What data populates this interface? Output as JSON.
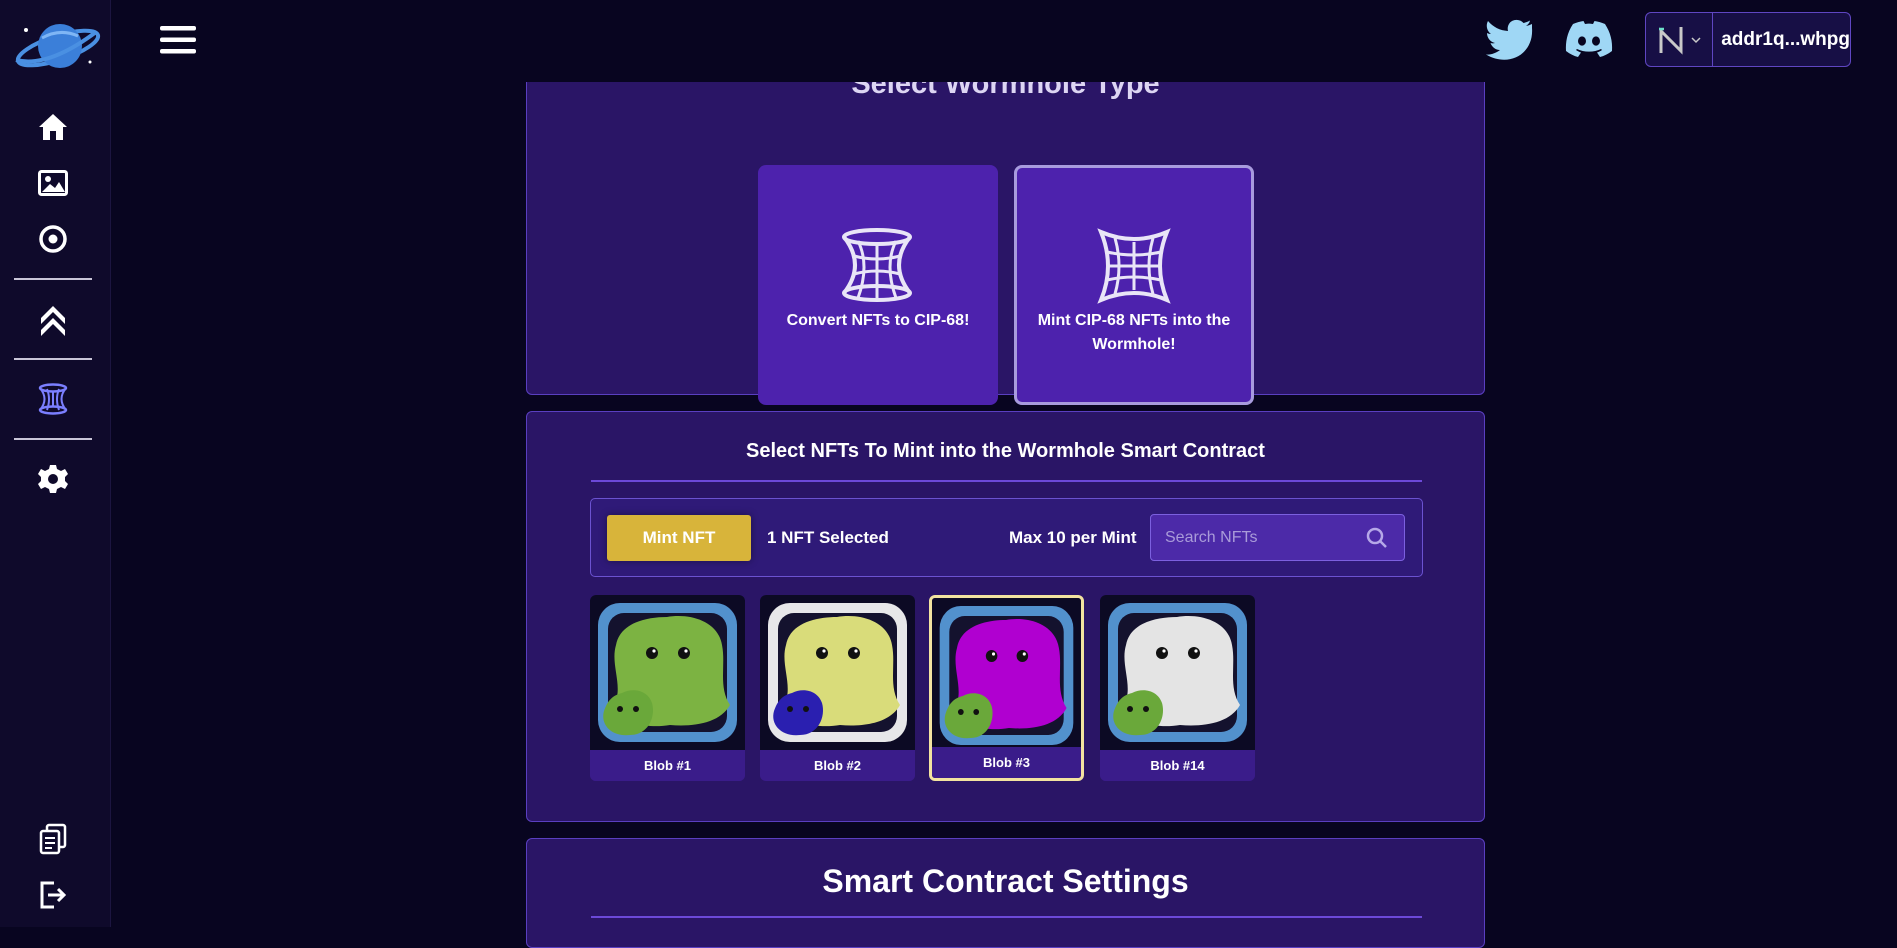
{
  "sidebar": {
    "logo": "planet-logo",
    "nav": [
      "home-icon",
      "image-icon",
      "target-icon",
      "chevron-up-icon",
      "wormhole-icon",
      "gear-icon"
    ],
    "bottom": [
      "documents-icon",
      "logout-icon"
    ],
    "active_color": "#7b7fff"
  },
  "topbar": {
    "menu_icon": "hamburger-icon",
    "social": [
      "twitter-icon",
      "discord-icon"
    ],
    "social_color": "#9fd7f5",
    "wallet": {
      "icon": "nami-wallet-icon",
      "address": "addr1q...whpg"
    }
  },
  "wormhole_type": {
    "title": "Select Wormhole Type",
    "options": [
      {
        "label": "Convert NFTs to CIP-68!",
        "icon": "wormhole-icon",
        "selected": false
      },
      {
        "label": "Mint CIP-68 NFTs into the Wormhole!",
        "icon": "wormhole-grid-icon",
        "selected": true
      }
    ]
  },
  "mint_section": {
    "title": "Select NFTs To Mint into the Wormhole Smart Contract",
    "mint_button": "Mint NFT",
    "selected_count": "1 NFT Selected",
    "max_per_mint": "Max 10 per Mint",
    "search": {
      "placeholder": "Search NFTs",
      "value": ""
    },
    "accent": "#d8b43a",
    "nfts": [
      {
        "name": "Blob #1",
        "color": "#7cb342",
        "small_color": "#6aa83a",
        "selected": false
      },
      {
        "name": "Blob #2",
        "color": "#d9dc7a",
        "small_color": "#2a1fb0",
        "selected": false
      },
      {
        "name": "Blob #3",
        "color": "#b000d0",
        "small_color": "#6aa83a",
        "selected": true
      },
      {
        "name": "Blob #14",
        "color": "#e4e4e4",
        "small_color": "#6aa83a",
        "selected": false
      }
    ]
  },
  "settings_section": {
    "title": "Smart Contract Settings"
  }
}
